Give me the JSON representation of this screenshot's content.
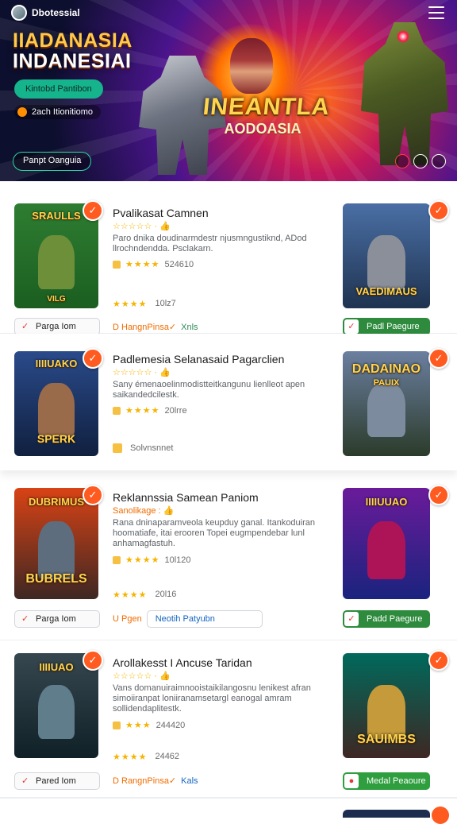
{
  "header": {
    "brand": "Dbotessial",
    "title_line1": "IIADANASIA",
    "title_line2": "INDANESIAI",
    "tag": "Kintobd Pantibon",
    "live_text": "2ach Itionitiomo",
    "cta": "Panpt Oanguia",
    "banner_title": "INEANTLA",
    "banner_subtitle": "AODOASIA"
  },
  "games": [
    {
      "title": "Pvalikasat Camnen",
      "rating_text": "☆☆☆☆☆ · 👍",
      "desc": "Paro dnika doudinarmdestr njusmngustiknd, ADod llrochndendda. Psclakarn.",
      "meta_value": "524610",
      "meta2_value": "10lz7",
      "button_left": "Parga Iom",
      "link_left": "D HangnPinsa✓",
      "link_right": "Xnls",
      "button_right": "Padl Paegure",
      "thumb_left_title": "SRAULLS",
      "thumb_left_sub": "VILG",
      "thumb_right_title": "VAEDIMAUS",
      "colors": {
        "left_top": "#2e7d32",
        "left_bottom": "#1b5e20",
        "right_top": "#4a6fa5",
        "right_bottom": "#1f3350",
        "fig_left": "#6d8f3a",
        "fig_right": "#8a8f9a"
      }
    },
    {
      "title": "Padlemesia Selanasaid Pagarclien",
      "rating_text": "☆☆☆☆☆ · 👍",
      "desc": "Sany émenaoelinmodistteitkangunu lienlleot apen saikandedcilestk.",
      "meta_value": "20lrre",
      "meta2_value": "Solvnsnnet",
      "thumb_left_title": "IIIIUAKO",
      "thumb_left_sub": "SPERK",
      "thumb_right_title": "DADAINAO",
      "thumb_right_sub": "PAUIX",
      "colors": {
        "left_top": "#2a4a8a",
        "left_bottom": "#10203f",
        "right_top": "#6b7fa0",
        "right_bottom": "#2b3b2a",
        "fig_left": "#9a6b4a",
        "fig_right": "#7c8c9e"
      }
    },
    {
      "title": "Reklannssia Samean Paniom",
      "rating_text": "Sanolikage : 👍",
      "desc": "Rana dninaparamveola keupduy ganal. Itankoduiran hoomatiafe, itai erooren Topei eugmpendebar lunl anhamagfastuh.",
      "meta_value": "10l120",
      "meta2_value": "20l16",
      "button_left": "Parga Iom",
      "link_left": "U Pgen",
      "field_value": "Neotih Patyubn",
      "button_right": "Padd Paegure",
      "thumb_left_title": "DUBRIMUS",
      "thumb_left_sub": "BUBRELS",
      "thumb_right_title": "IIIIUUAO",
      "colors": {
        "left_top": "#d84315",
        "left_bottom": "#3e2723",
        "right_top": "#6a1b9a",
        "right_bottom": "#1a237e",
        "fig_left": "#5d6d7e",
        "fig_right": "#ad1457"
      }
    },
    {
      "title": "Arollakesst I Ancuse Taridan",
      "rating_text": "☆☆☆☆☆ · 👍",
      "desc": "Vans domanuiraimnooistaikilangosnu lenikest afran simoiiranpat loniiranamsetargl eanogal amram sollidendaplitestk.",
      "meta_value": "244420",
      "meta2_value": "24462",
      "button_left": "Pared Iom",
      "link_left": "D RangnPinsa✓",
      "link_right": "Kals",
      "button_right": "Medal Peaoure",
      "thumb_left_title": "IIIIUAO",
      "thumb_right_title": "SAUIMBS",
      "colors": {
        "left_top": "#37474f",
        "left_bottom": "#102027",
        "right_top": "#00695c",
        "right_bottom": "#3e2723",
        "fig_left": "#607d8b",
        "fig_right": "#c49a3a"
      }
    }
  ]
}
